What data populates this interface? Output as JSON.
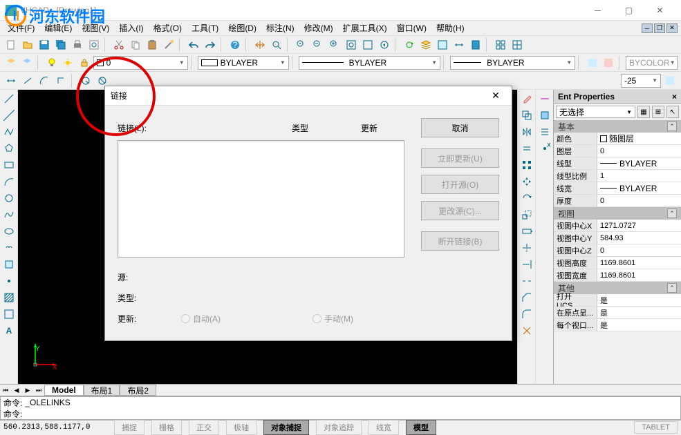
{
  "window": {
    "title": "VHCAD - [Drawing1]"
  },
  "watermark": {
    "text": "河东软件园"
  },
  "menu": {
    "file": "文件(F)",
    "edit": "编辑(E)",
    "view": "视图(V)",
    "insert": "插入(I)",
    "format": "格式(O)",
    "tools": "工具(T)",
    "draw": "绘图(D)",
    "annotate": "标注(N)",
    "modify": "修改(M)",
    "extensions": "扩展工具(X)",
    "window": "窗口(W)",
    "help": "帮助(H)"
  },
  "layer": {
    "current": "0",
    "color_text": "BYLAYER",
    "linetype": "BYLAYER",
    "lineweight": "BYLAYER",
    "bycolor": "BYCOLOR",
    "scale": "-25"
  },
  "tabs": {
    "model": "Model",
    "layout1": "布局1",
    "layout2": "布局2"
  },
  "command": {
    "prefix": "命令:",
    "last": "_OLELINKS",
    "current": ""
  },
  "status": {
    "coords": "560.2313,588.1177,0",
    "snap": "捕捉",
    "grid": "栅格",
    "ortho": "正交",
    "polar": "极轴",
    "osnap": "对象捕捉",
    "otrack": "对象追踪",
    "lwt": "线宽",
    "model": "模型",
    "tablet": "TABLET"
  },
  "props": {
    "title": "Ent Properties",
    "selector": "无选择",
    "section_basic": "基本",
    "color": "颜色",
    "color_val": "随图层",
    "layer": "图层",
    "layer_val": "0",
    "linetype": "线型",
    "linetype_val": "BYLAYER",
    "ltscale": "线型比例",
    "ltscale_val": "1",
    "lineweight": "线宽",
    "lineweight_val": "BYLAYER",
    "thickness": "厚度",
    "thickness_val": "0",
    "section_view": "视图",
    "center_x": "视图中心X",
    "center_x_val": "1271.0727",
    "center_y": "视图中心Y",
    "center_y_val": "584.93",
    "center_z": "视图中心Z",
    "center_z_val": "0",
    "height": "视图高度",
    "height_val": "1169.8601",
    "width": "视图宽度",
    "width_val": "1169.8601",
    "section_other": "其他",
    "ucs": "打开UCS...",
    "ucs_val": "是",
    "origin": "在原点显...",
    "origin_val": "是",
    "viewport": "每个视口...",
    "viewport_val": "是"
  },
  "dialog": {
    "title": "链接",
    "links_label": "链接(L):",
    "type_col": "类型",
    "update_col": "更新",
    "source_label": "源:",
    "type_label": "类型:",
    "update_label": "更新:",
    "auto": "自动(A)",
    "manual": "手动(M)",
    "cancel": "取消",
    "update_now": "立即更新(U)",
    "open_source": "打开源(O)",
    "change_source": "更改源(C)...",
    "break_link": "断开链接(B)"
  },
  "axes": {
    "x": "X",
    "y": "Y"
  }
}
